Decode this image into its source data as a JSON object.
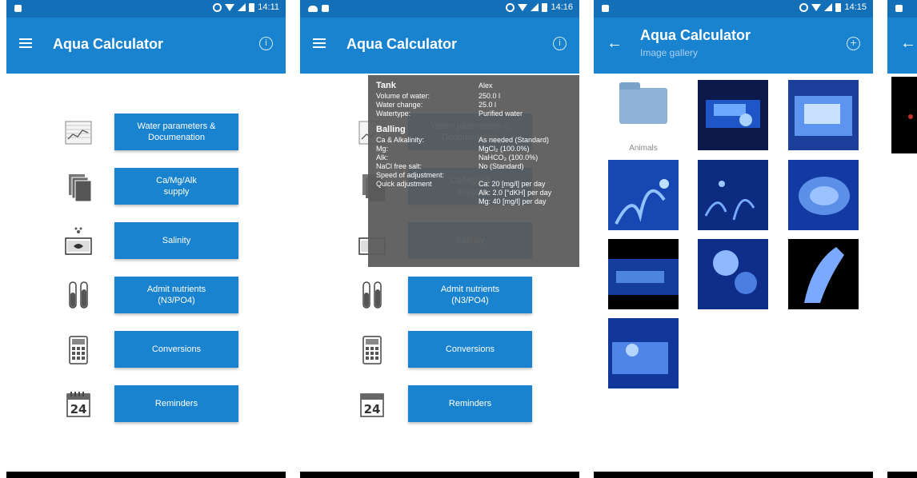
{
  "status_bar": {
    "time_1": "14:11",
    "time_2": "14:16",
    "time_3": "14:15"
  },
  "app": {
    "title": "Aqua Calculator",
    "gallery_subtitle": "Image gallery"
  },
  "icons": {
    "menu": "hamburger-menu-icon",
    "info": "info-icon",
    "add": "add-icon",
    "back": "back-arrow-icon"
  },
  "menu": {
    "items": [
      {
        "label": "Water parameters &\nDocumenation",
        "icon": "chart-icon"
      },
      {
        "label": "Ca/Mg/Alk\nsupply",
        "icon": "documents-icon"
      },
      {
        "label": "Salinity",
        "icon": "fish-tank-icon"
      },
      {
        "label": "Admit nutrients\n(N3/PO4)",
        "icon": "test-tubes-icon"
      },
      {
        "label": "Conversions",
        "icon": "calculator-icon"
      },
      {
        "label": "Reminders",
        "icon": "calendar-icon"
      }
    ],
    "calendar_day": "24"
  },
  "popup": {
    "tank_title": "Tank",
    "tank_value": "Alex",
    "rows_tank": [
      {
        "k": "Volume of water:",
        "v": "250.0 l"
      },
      {
        "k": "Water change:",
        "v": "25.0 l"
      },
      {
        "k": "Watertype:",
        "v": "Purified water"
      }
    ],
    "balling_title": "Balling",
    "rows_balling": [
      {
        "k": "Ca & Alkalinity:",
        "v": "As needed (Standard)"
      },
      {
        "k": "Mg:",
        "v": "MgCl₂ (100.0%)"
      },
      {
        "k": "Alk:",
        "v": "NaHCO₃ (100.0%)"
      },
      {
        "k": "NaCl free salt:",
        "v": "No (Standard)"
      },
      {
        "k": "Speed of adjustment:",
        "v": ""
      },
      {
        "k": "Quick adjustment",
        "v": "Ca: 20 [mg/l] per day\nAlk: 2.0 [°dKH] per day\nMg: 40 [mg/l] per day"
      }
    ]
  },
  "gallery": {
    "folder_label": "Animals",
    "thumbnail_count": 10
  },
  "colors": {
    "status_bar": "#1370b8",
    "app_bar": "#1a83d0",
    "button": "#1a83d0",
    "popup": "#5a5a5a"
  }
}
